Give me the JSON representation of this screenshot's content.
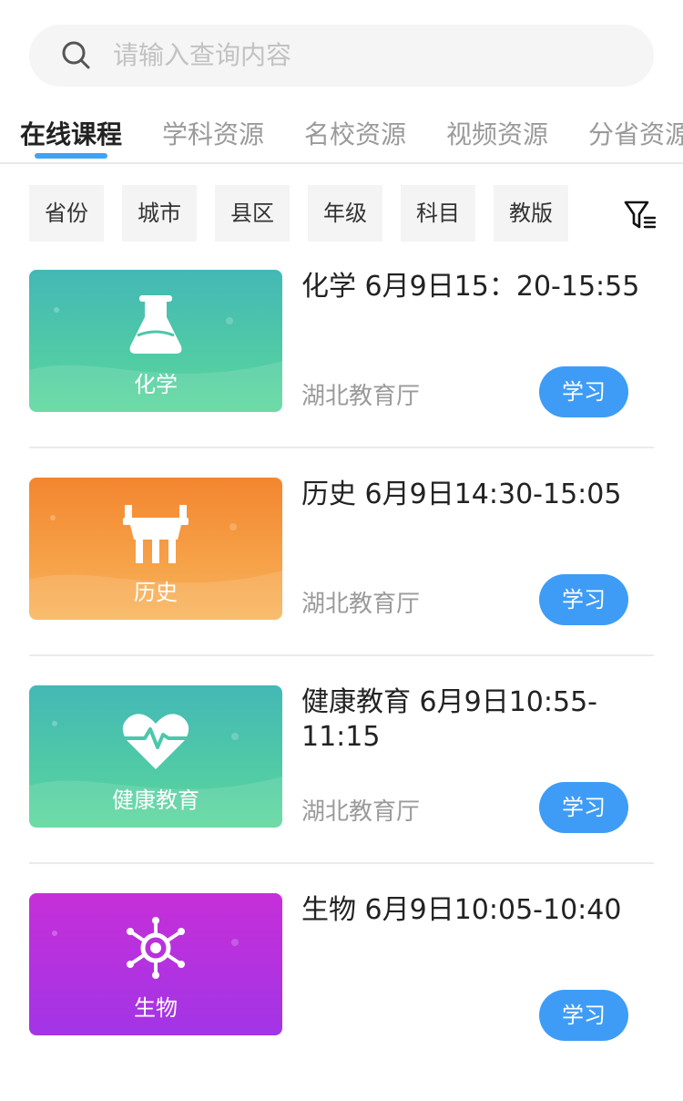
{
  "search": {
    "placeholder": "请输入查询内容"
  },
  "tabs": [
    {
      "label": "在线课程",
      "active": true
    },
    {
      "label": "学科资源",
      "active": false
    },
    {
      "label": "名校资源",
      "active": false
    },
    {
      "label": "视频资源",
      "active": false
    },
    {
      "label": "分省资源",
      "active": false
    }
  ],
  "filters": [
    "省份",
    "城市",
    "县区",
    "年级",
    "科目",
    "教版"
  ],
  "filter_icon": "filter-icon",
  "courses": [
    {
      "subject": "化学",
      "title": "化学 6月9日15：20-15:55",
      "source": "湖北教育厅",
      "button": "学习",
      "icon": "flask-icon",
      "colors": [
        "#43b8b6",
        "#5ad79a"
      ]
    },
    {
      "subject": "历史",
      "title": "历史 6月9日14:30-15:05",
      "source": "湖北教育厅",
      "button": "学习",
      "icon": "bronze-ding-icon",
      "colors": [
        "#f3862f",
        "#f8b45a"
      ]
    },
    {
      "subject": "健康教育",
      "title": "健康教育 6月9日10:55-11:15",
      "source": "湖北教育厅",
      "button": "学习",
      "icon": "heart-pulse-icon",
      "colors": [
        "#43b8b6",
        "#5ad79a"
      ]
    },
    {
      "subject": "生物",
      "title": "生物 6月9日10:05-10:40",
      "source": "",
      "button": "学习",
      "icon": "molecule-icon",
      "colors": [
        "#c62fd8",
        "#a235e6"
      ]
    }
  ]
}
